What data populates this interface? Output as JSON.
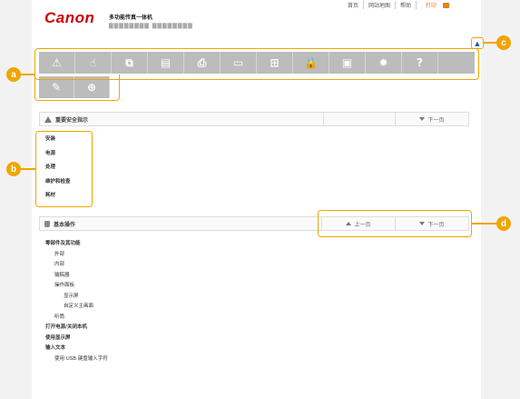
{
  "header": {
    "logo": "Canon",
    "product_title": "多功能传真一体机",
    "product_model": "▇▇▇▇▇▇▇▇ ▇▇▇▇▇▇▇▇",
    "links": [
      "首页",
      "网站地图",
      "帮助"
    ],
    "print_label": "打印"
  },
  "toolbar": {
    "row1": [
      {
        "icon": "warning-icon",
        "glyph": "⚠"
      },
      {
        "icon": "hand-icon",
        "glyph": "☝"
      },
      {
        "icon": "copy-icon",
        "glyph": "⧉"
      },
      {
        "icon": "fax-icon",
        "glyph": "▤"
      },
      {
        "icon": "printer-icon",
        "glyph": "⎙"
      },
      {
        "icon": "scan-icon",
        "glyph": "▭"
      },
      {
        "icon": "network-icon",
        "glyph": "⊞"
      },
      {
        "icon": "lock-icon",
        "glyph": "🔒"
      },
      {
        "icon": "remote-ui-icon",
        "glyph": "▣"
      },
      {
        "icon": "settings-gear-icon",
        "glyph": "✹"
      },
      {
        "icon": "help-question-icon",
        "glyph": "?"
      }
    ],
    "row2": [
      {
        "icon": "wrench-icon",
        "glyph": "✎"
      },
      {
        "icon": "plus-circle-icon",
        "glyph": "⊕"
      }
    ]
  },
  "safety_section": {
    "title": "重要安全指示",
    "next_label": "下一页",
    "items": [
      "安装",
      "电源",
      "处理",
      "维护和检查",
      "耗材"
    ]
  },
  "basic_section": {
    "title": "基本操作",
    "prev_label": "上一页",
    "next_label": "下一页",
    "items": [
      {
        "label": "零部件及其功能",
        "level": "b"
      },
      {
        "label": "外部",
        "level": "l1"
      },
      {
        "label": "内部",
        "level": "l1"
      },
      {
        "label": "输稿器",
        "level": "l1"
      },
      {
        "label": "操作面板",
        "level": "l1"
      },
      {
        "label": "显示屏",
        "level": "l2"
      },
      {
        "label": "自定义主画面",
        "level": "l2"
      },
      {
        "label": "听筒",
        "level": "l1"
      },
      {
        "label": "打开电源/关闭本机",
        "level": "b"
      },
      {
        "label": "使用显示屏",
        "level": "b"
      },
      {
        "label": "输入文本",
        "level": "b"
      },
      {
        "label": "使用 USB 键盘输入字符",
        "level": "l1"
      }
    ]
  },
  "callouts": {
    "a": "a",
    "b": "b",
    "c": "c",
    "d": "d"
  },
  "colors": {
    "accent": "#f0a500",
    "brand": "#cc0000",
    "icon_bg": "#bcbcbc"
  }
}
